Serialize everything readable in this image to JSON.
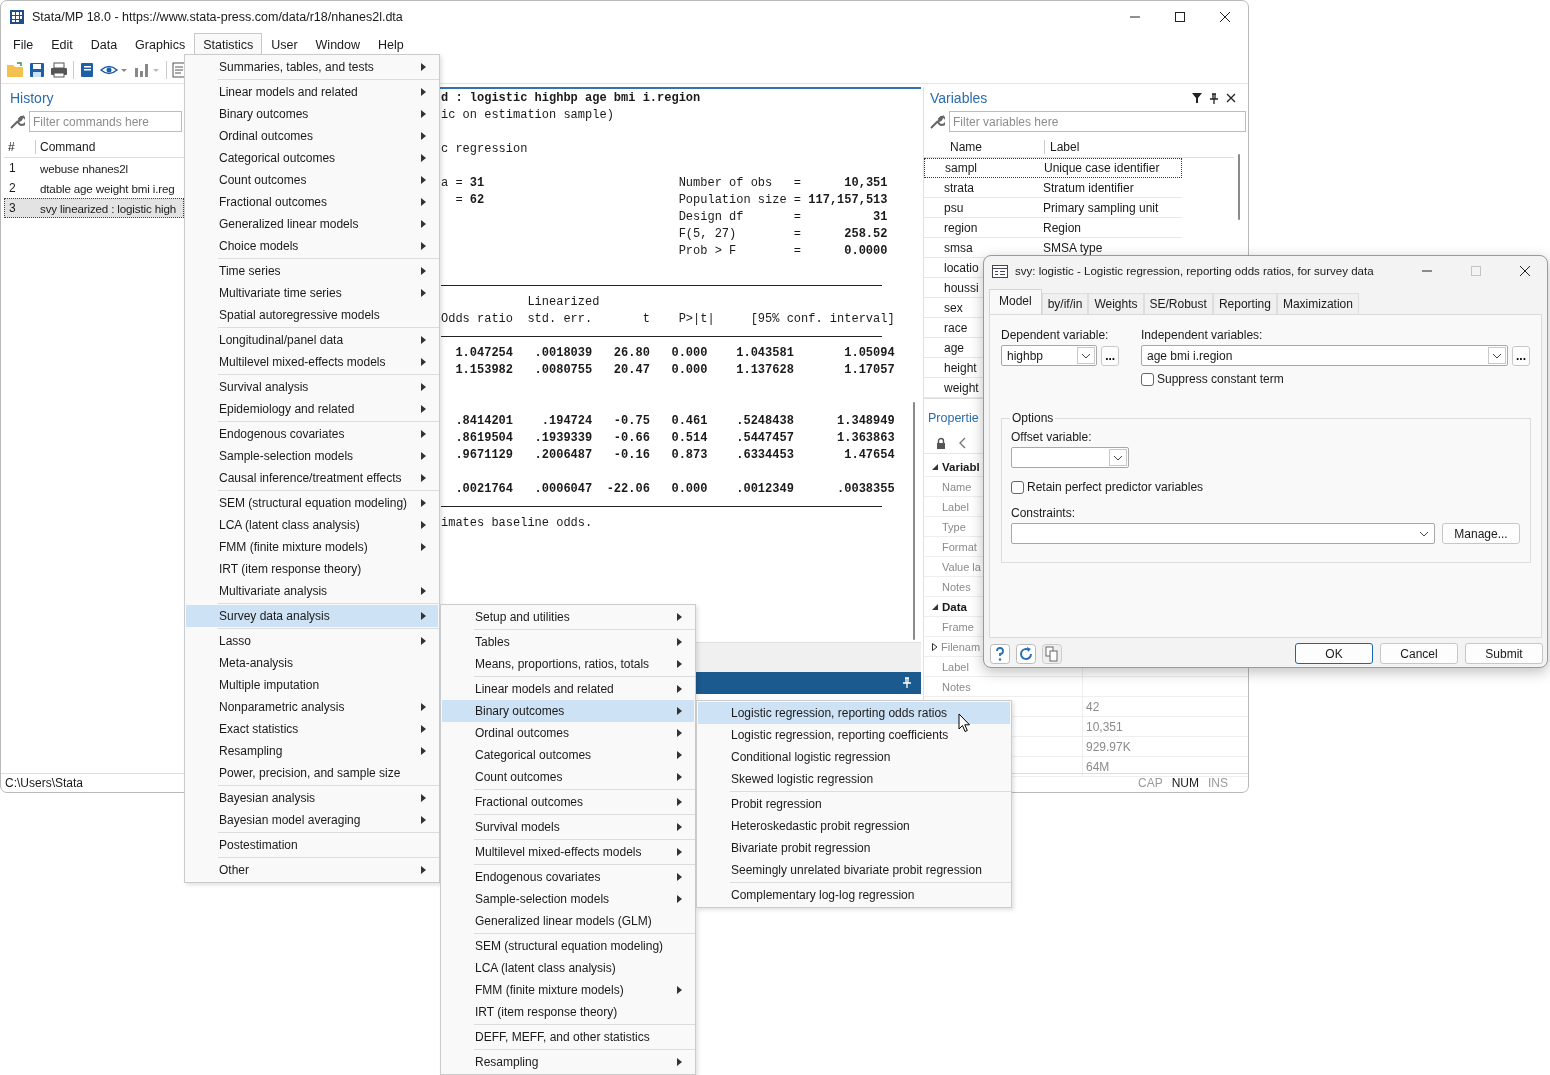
{
  "window": {
    "title": "Stata/MP 18.0 - https://www.stata-press.com/data/r18/nhanes2l.dta"
  },
  "menu_bar": [
    {
      "label": "File",
      "selected": false
    },
    {
      "label": "Edit",
      "selected": false
    },
    {
      "label": "Data",
      "selected": false
    },
    {
      "label": "Graphics",
      "selected": false
    },
    {
      "label": "Statistics",
      "selected": true
    },
    {
      "label": "User",
      "selected": false
    },
    {
      "label": "Window",
      "selected": false
    },
    {
      "label": "Help",
      "selected": false
    }
  ],
  "history": {
    "title": "History",
    "filter": {
      "placeholder": "Filter commands here"
    },
    "columns": [
      "#",
      "Command"
    ],
    "rows": [
      {
        "number": "1",
        "command": "webuse nhanes2l",
        "selected": false
      },
      {
        "number": "2",
        "command": "dtable age weight bmi i.reg",
        "selected": false
      },
      {
        "number": "3",
        "command": "svy linearized : logistic high",
        "selected": true
      }
    ]
  },
  "results": {
    "lines": [
      {
        "kind": "text",
        "text": "d : logistic highbp age bmi i.region",
        "bold": true
      },
      {
        "kind": "text",
        "text": "ic on estimation sample)",
        "bold": false
      },
      {
        "kind": "blank"
      },
      {
        "kind": "text",
        "text": "c regression",
        "bold": false
      },
      {
        "kind": "blank"
      },
      {
        "kind": "text",
        "text": "a = **31**                           Number of obs   =      **10,351**",
        "bold": false
      },
      {
        "kind": "text",
        "text": "  = **62**                           Population size = **117,157,513**",
        "bold": false
      },
      {
        "kind": "text",
        "text": "                                 Design df       =          **31**",
        "bold": false
      },
      {
        "kind": "text",
        "text": "                                 F(5, 27)        =      **258.52**",
        "bold": false
      },
      {
        "kind": "text",
        "text": "                                 Prob > F        =      **0.0000**",
        "bold": false
      },
      {
        "kind": "blank"
      },
      {
        "kind": "rule"
      },
      {
        "kind": "text",
        "text": "            Linearized",
        "bold": false
      },
      {
        "kind": "text",
        "text": "Odds ratio  std. err.       t    P>|t|     [95% conf. interval]",
        "bold": false
      },
      {
        "kind": "rule"
      },
      {
        "kind": "text",
        "text": "  1.047254   .0018039   26.80   0.000    1.043581       1.05094",
        "bold": true
      },
      {
        "kind": "text",
        "text": "  1.153982   .0080755   20.47   0.000    1.137628       1.17057",
        "bold": true
      },
      {
        "kind": "blank"
      },
      {
        "kind": "blank"
      },
      {
        "kind": "text",
        "text": "  .8414201    .194724   -0.75   0.461    .5248438      1.348949",
        "bold": true
      },
      {
        "kind": "text",
        "text": "  .8619504   .1939339   -0.66   0.514    .5447457      1.363863",
        "bold": true
      },
      {
        "kind": "text",
        "text": "  .9671129   .2006487   -0.16   0.873    .6334453       1.47654",
        "bold": true
      },
      {
        "kind": "blank"
      },
      {
        "kind": "text",
        "text": "  .0021764   .0006047  -22.06   0.000    .0012349      .0038355",
        "bold": true
      },
      {
        "kind": "rule"
      },
      {
        "kind": "text",
        "text": "imates baseline odds.",
        "bold": false
      }
    ]
  },
  "variables": {
    "title": "Variables",
    "filter": {
      "placeholder": "Filter variables here"
    },
    "columns": [
      "Name",
      "Label"
    ],
    "rows": [
      {
        "name": "sampl",
        "label": "Unique case identifier",
        "selected": true
      },
      {
        "name": "strata",
        "label": "Stratum identifier",
        "selected": false
      },
      {
        "name": "psu",
        "label": "Primary sampling unit",
        "selected": false
      },
      {
        "name": "region",
        "label": "Region",
        "selected": false
      },
      {
        "name": "smsa",
        "label": "SMSA type",
        "selected": false
      },
      {
        "name": "locatio",
        "selected": false
      },
      {
        "name": "houssi",
        "selected": false
      },
      {
        "name": "sex",
        "selected": false
      },
      {
        "name": "race",
        "selected": false
      },
      {
        "name": "age",
        "selected": false
      },
      {
        "name": "height",
        "selected": false
      },
      {
        "name": "weight",
        "selected": false
      }
    ]
  },
  "properties": {
    "title": "Propertie",
    "sections": [
      {
        "title": "Variabl",
        "expanded": true,
        "rows": [
          {
            "name": "Name",
            "expandable": false
          },
          {
            "name": "Label",
            "expandable": false
          },
          {
            "name": "Type",
            "expandable": false
          },
          {
            "name": "Format",
            "expandable": false
          },
          {
            "name": "Value la",
            "expandable": false
          },
          {
            "name": "Notes",
            "expandable": false
          }
        ]
      },
      {
        "title": "Data",
        "expanded": true,
        "rows": [
          {
            "name": "Frame",
            "expandable": false
          },
          {
            "name": "Filenam",
            "expandable": true
          },
          {
            "name": "Label",
            "expandable": false
          },
          {
            "name": "Notes",
            "expandable": false
          },
          {
            "value": "42",
            "expandable": false
          },
          {
            "value": "10,351",
            "expandable": false
          },
          {
            "value": "929.97K",
            "expandable": false
          },
          {
            "value": "64M",
            "expandable": false
          }
        ]
      }
    ]
  },
  "status_bar": {
    "path": "C:\\Users\\Stata",
    "indicators": [
      {
        "label": "CAP",
        "on": false
      },
      {
        "label": "NUM",
        "on": true
      },
      {
        "label": "INS",
        "on": false
      }
    ]
  },
  "statistics_menu": {
    "groups": [
      [
        {
          "label": "Summaries, tables, and tests",
          "submenu": true,
          "selected": false
        }
      ],
      [
        {
          "label": "Linear models and related",
          "submenu": true,
          "selected": false
        },
        {
          "label": "Binary outcomes",
          "submenu": true,
          "selected": false
        },
        {
          "label": "Ordinal outcomes",
          "submenu": true,
          "selected": false
        },
        {
          "label": "Categorical outcomes",
          "submenu": true,
          "selected": false
        },
        {
          "label": "Count outcomes",
          "submenu": true,
          "selected": false
        },
        {
          "label": "Fractional outcomes",
          "submenu": true,
          "selected": false
        },
        {
          "label": "Generalized linear models",
          "submenu": true,
          "selected": false
        },
        {
          "label": "Choice models",
          "submenu": true,
          "selected": false
        }
      ],
      [
        {
          "label": "Time series",
          "submenu": true,
          "selected": false
        },
        {
          "label": "Multivariate time series",
          "submenu": true,
          "selected": false
        },
        {
          "label": "Spatial autoregressive models",
          "submenu": false,
          "selected": false
        }
      ],
      [
        {
          "label": "Longitudinal/panel data",
          "submenu": true,
          "selected": false
        },
        {
          "label": "Multilevel mixed-effects models",
          "submenu": true,
          "selected": false
        }
      ],
      [
        {
          "label": "Survival analysis",
          "submenu": true,
          "selected": false
        },
        {
          "label": "Epidemiology and related",
          "submenu": true,
          "selected": false
        }
      ],
      [
        {
          "label": "Endogenous covariates",
          "submenu": true,
          "selected": false
        },
        {
          "label": "Sample-selection models",
          "submenu": true,
          "selected": false
        },
        {
          "label": "Causal inference/treatment effects",
          "submenu": true,
          "selected": false
        }
      ],
      [
        {
          "label": "SEM (structural equation modeling)",
          "submenu": true,
          "selected": false
        },
        {
          "label": "LCA (latent class analysis)",
          "submenu": true,
          "selected": false
        },
        {
          "label": "FMM (finite mixture models)",
          "submenu": true,
          "selected": false
        },
        {
          "label": "IRT (item response theory)",
          "submenu": false,
          "selected": false
        },
        {
          "label": "Multivariate analysis",
          "submenu": true,
          "selected": false
        }
      ],
      [
        {
          "label": "Survey data analysis",
          "submenu": true,
          "selected": true
        }
      ],
      [
        {
          "label": "Lasso",
          "submenu": true,
          "selected": false
        },
        {
          "label": "Meta-analysis",
          "submenu": false,
          "selected": false
        },
        {
          "label": "Multiple imputation",
          "submenu": false,
          "selected": false
        },
        {
          "label": "Nonparametric analysis",
          "submenu": true,
          "selected": false
        },
        {
          "label": "Exact statistics",
          "submenu": true,
          "selected": false
        },
        {
          "label": "Resampling",
          "submenu": true,
          "selected": false
        },
        {
          "label": "Power, precision, and sample size",
          "submenu": false,
          "selected": false
        }
      ],
      [
        {
          "label": "Bayesian analysis",
          "submenu": true,
          "selected": false
        },
        {
          "label": "Bayesian model averaging",
          "submenu": true,
          "selected": false
        }
      ],
      [
        {
          "label": "Postestimation",
          "submenu": false,
          "selected": false
        }
      ],
      [
        {
          "label": "Other",
          "submenu": true,
          "selected": false
        }
      ]
    ]
  },
  "survey_menu": {
    "groups": [
      [
        {
          "label": "Setup and utilities",
          "submenu": true,
          "selected": false
        }
      ],
      [
        {
          "label": "Tables",
          "submenu": true,
          "selected": false
        },
        {
          "label": "Means, proportions, ratios, totals",
          "submenu": true,
          "selected": false
        }
      ],
      [
        {
          "label": "Linear models and related",
          "submenu": true,
          "selected": false
        },
        {
          "label": "Binary outcomes",
          "submenu": true,
          "selected": true
        },
        {
          "label": "Ordinal outcomes",
          "submenu": true,
          "selected": false
        },
        {
          "label": "Categorical outcomes",
          "submenu": true,
          "selected": false
        },
        {
          "label": "Count outcomes",
          "submenu": true,
          "selected": false
        }
      ],
      [
        {
          "label": "Fractional outcomes",
          "submenu": true,
          "selected": false
        }
      ],
      [
        {
          "label": "Survival models",
          "submenu": true,
          "selected": false
        }
      ],
      [
        {
          "label": "Multilevel mixed-effects models",
          "submenu": true,
          "selected": false
        }
      ],
      [
        {
          "label": "Endogenous covariates",
          "submenu": true,
          "selected": false
        },
        {
          "label": "Sample-selection models",
          "submenu": true,
          "selected": false
        },
        {
          "label": "Generalized linear models (GLM)",
          "submenu": false,
          "selected": false
        }
      ],
      [
        {
          "label": "SEM (structural equation modeling)",
          "submenu": false,
          "selected": false
        },
        {
          "label": "LCA (latent class analysis)",
          "submenu": false,
          "selected": false
        },
        {
          "label": "FMM (finite mixture models)",
          "submenu": true,
          "selected": false
        },
        {
          "label": "IRT (item response theory)",
          "submenu": false,
          "selected": false
        }
      ],
      [
        {
          "label": "DEFF, MEFF, and other statistics",
          "submenu": false,
          "selected": false
        }
      ],
      [
        {
          "label": "Resampling",
          "submenu": true,
          "selected": false
        }
      ]
    ]
  },
  "binary_menu": {
    "groups": [
      [
        {
          "label": "Logistic regression, reporting odds ratios",
          "submenu": false,
          "selected": true
        },
        {
          "label": "Logistic regression, reporting coefficients",
          "submenu": false,
          "selected": false
        },
        {
          "label": "Conditional logistic regression",
          "submenu": false,
          "selected": false
        },
        {
          "label": "Skewed logistic regression",
          "submenu": false,
          "selected": false
        }
      ],
      [
        {
          "label": "Probit regression",
          "submenu": false,
          "selected": false
        },
        {
          "label": "Heteroskedastic probit regression",
          "submenu": false,
          "selected": false
        },
        {
          "label": "Bivariate probit regression",
          "submenu": false,
          "selected": false
        },
        {
          "label": "Seemingly unrelated bivariate probit regression",
          "submenu": false,
          "selected": false
        }
      ],
      [
        {
          "label": "Complementary log-log regression",
          "submenu": false,
          "selected": false
        }
      ]
    ]
  },
  "dialog": {
    "title": "svy: logistic - Logistic regression, reporting odds ratios, for survey data",
    "tabs": [
      {
        "label": "Model",
        "selected": true
      },
      {
        "label": "by/if/in",
        "selected": false
      },
      {
        "label": "Weights",
        "selected": false
      },
      {
        "label": "SE/Robust",
        "selected": false
      },
      {
        "label": "Reporting",
        "selected": false
      },
      {
        "label": "Maximization",
        "selected": false
      }
    ],
    "dependent": {
      "label": "Dependent variable:",
      "value": "highbp",
      "browse": "..."
    },
    "independent": {
      "label": "Independent variables:",
      "value": "age bmi i.region",
      "browse": "..."
    },
    "suppress_constant": {
      "label": "Suppress constant term",
      "checked": false
    },
    "options": {
      "title": "Options",
      "offset": {
        "label": "Offset variable:"
      },
      "retain": {
        "label": "Retain perfect predictor variables",
        "checked": false
      },
      "constraints": {
        "label": "Constraints:"
      },
      "manage": "Manage..."
    },
    "buttons": [
      {
        "label": "OK",
        "default": true
      },
      {
        "label": "Cancel",
        "default": false
      },
      {
        "label": "Submit",
        "default": false
      }
    ]
  }
}
